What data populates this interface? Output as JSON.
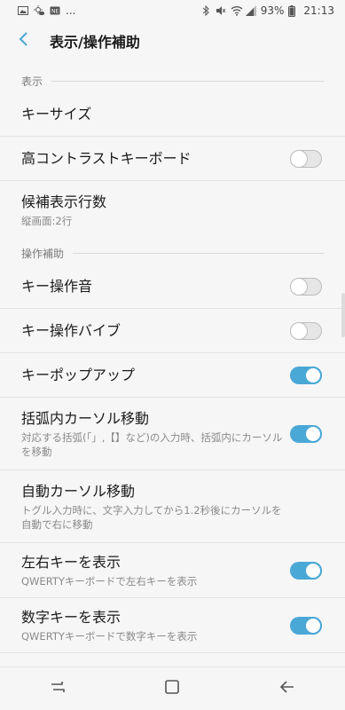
{
  "status_bar": {
    "left_more": "...",
    "battery_percent": "93%",
    "time": "21:13"
  },
  "header": {
    "title": "表示/操作補助"
  },
  "sections": {
    "display": {
      "header": "表示",
      "key_size": {
        "title": "キーサイズ"
      },
      "high_contrast": {
        "title": "高コントラストキーボード",
        "enabled": false
      },
      "candidate_rows": {
        "title": "候補表示行数",
        "subtitle": "縦画面:2行"
      }
    },
    "assist": {
      "header": "操作補助",
      "key_sound": {
        "title": "キー操作音",
        "enabled": false
      },
      "key_vibrate": {
        "title": "キー操作バイブ",
        "enabled": false
      },
      "key_popup": {
        "title": "キーポップアップ",
        "enabled": true
      },
      "bracket_cursor": {
        "title": "括弧内カーソル移動",
        "subtitle": "対応する括弧(「」,【】など)の入力時、括弧内にカーソルを移動",
        "enabled": true
      },
      "auto_cursor": {
        "title": "自動カーソル移動",
        "subtitle": "トグル入力時に、文字入力してから1.2秒後にカーソルを自動で右に移動"
      },
      "lr_keys": {
        "title": "左右キーを表示",
        "subtitle": "QWERTYキーボードで左右キーを表示",
        "enabled": true
      },
      "num_keys": {
        "title": "数字キーを表示",
        "subtitle": "QWERTYキーボードで数字キーを表示",
        "enabled": true
      }
    }
  },
  "colors": {
    "accent": "#4aa8d6",
    "background": "#f6f6f6",
    "divider": "#e3e3e3"
  },
  "icons": {
    "back": "back-arrow-icon",
    "nav_recents": "recents-icon",
    "nav_home": "home-icon",
    "nav_back": "nav-back-icon"
  }
}
